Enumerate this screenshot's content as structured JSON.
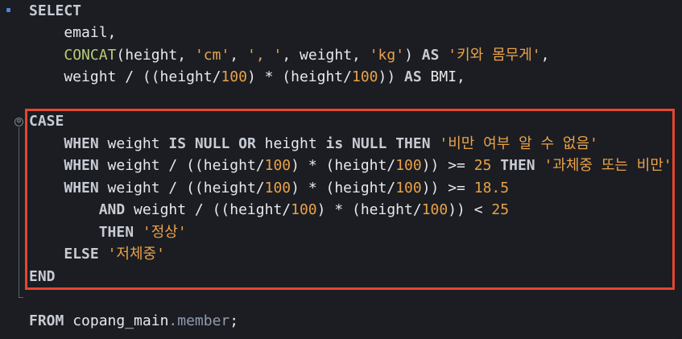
{
  "editor": {
    "lines": [
      {
        "parts": [
          "SELECT"
        ]
      },
      {
        "parts": [
          "    email,"
        ]
      },
      {
        "parts": [
          "    ",
          "CONCAT",
          "(height, ",
          "'cm'",
          ", ",
          "', '",
          ", weight, ",
          "'kg'",
          ") ",
          "AS",
          " ",
          "'키와 몸무게'",
          ","
        ]
      },
      {
        "parts": [
          "    weight / ((height/",
          "100",
          ") * (height/",
          "100",
          ")) ",
          "AS",
          " BMI,"
        ]
      },
      {
        "parts": [
          ""
        ]
      },
      {
        "parts": [
          "CASE"
        ]
      },
      {
        "parts": [
          "    ",
          "WHEN",
          " weight ",
          "IS NULL OR",
          " height ",
          "is NULL THEN",
          " ",
          "'비만 여부 알 수 없음'"
        ]
      },
      {
        "parts": [
          "    ",
          "WHEN",
          " weight / ((height/",
          "100",
          ") * (height/",
          "100",
          ")) >= ",
          "25",
          " ",
          "THEN",
          " ",
          "'과체중 또는 비만'"
        ]
      },
      {
        "parts": [
          "    ",
          "WHEN",
          " weight / ((height/",
          "100",
          ") * (height/",
          "100",
          ")) >= ",
          "18.5"
        ]
      },
      {
        "parts": [
          "        ",
          "AND",
          " weight / ((height/",
          "100",
          ") * (height/",
          "100",
          ")) < ",
          "25"
        ]
      },
      {
        "parts": [
          "        ",
          "THEN",
          " ",
          "'정상'"
        ]
      },
      {
        "parts": [
          "    ",
          "ELSE",
          " ",
          "'저체중'"
        ]
      },
      {
        "parts": [
          "END"
        ]
      },
      {
        "parts": [
          ""
        ]
      },
      {
        "parts": [
          "FROM",
          " copang_main",
          ".member",
          ";"
        ]
      }
    ]
  },
  "colors": {
    "keyword": "#c7cbd4",
    "function": "#b9cc74",
    "string": "#e9a24a",
    "highlight_border": "#e3472f",
    "background": "#1b1d22"
  },
  "icons": {
    "fold": "fold-collapse-icon",
    "breakpoint": "line-marker-icon"
  }
}
